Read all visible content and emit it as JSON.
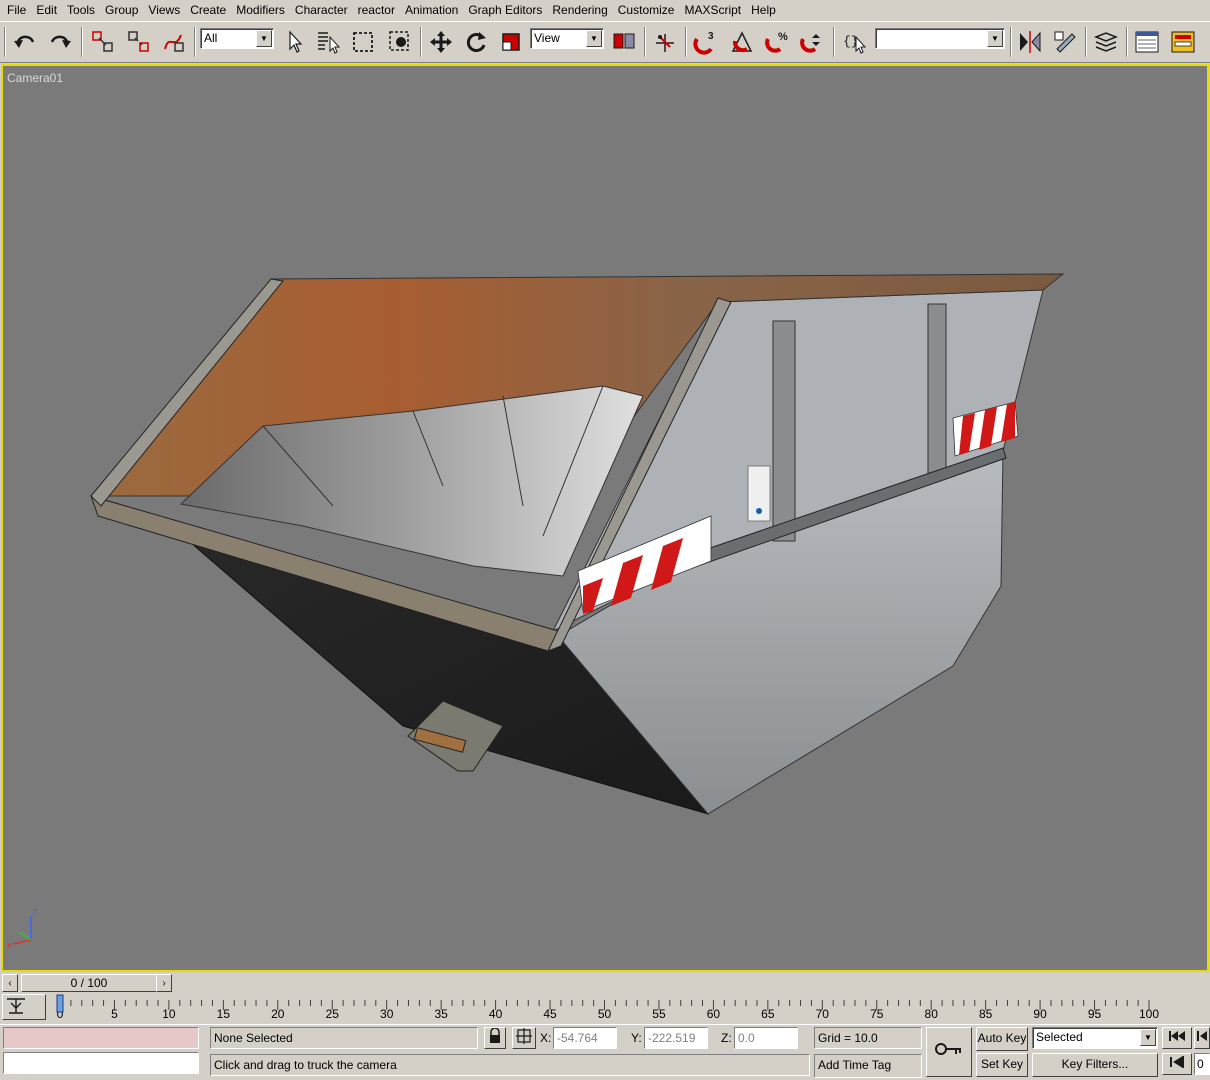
{
  "menu": [
    "File",
    "Edit",
    "Tools",
    "Group",
    "Views",
    "Create",
    "Modifiers",
    "Character",
    "reactor",
    "Animation",
    "Graph Editors",
    "Rendering",
    "Customize",
    "MAXScript",
    "Help"
  ],
  "toolbar": {
    "selection_filter": "All",
    "reference_coord": "View",
    "named_selection": "",
    "snap_label": "3",
    "percent_snap_label": "%"
  },
  "viewport": {
    "label": "Camera01",
    "border_color": "#e7dc00",
    "background": "#7a7a7a",
    "axis_labels": [
      "z",
      "x"
    ]
  },
  "timeslider": {
    "position": "0 / 100",
    "frame": 0,
    "total": 100
  },
  "trackbar": {
    "ticks": [
      "0",
      "5",
      "10",
      "15",
      "20",
      "25",
      "30",
      "35",
      "40",
      "45",
      "50",
      "55",
      "60",
      "65",
      "70",
      "75",
      "80",
      "85",
      "90",
      "95",
      "100"
    ]
  },
  "status": {
    "selection": "None Selected",
    "prompt": "Click and drag to truck the camera",
    "x_label": "X:",
    "x_value": "-54.764",
    "y_label": "Y:",
    "y_value": "-222.519",
    "z_label": "Z:",
    "z_value": "0.0",
    "grid": "Grid = 10.0",
    "add_time_tag": "Add Time Tag",
    "auto_key": "Auto Key",
    "set_key": "Set Key",
    "key_mode": "Selected",
    "key_filters": "Key Filters...",
    "frame_field": "0"
  }
}
